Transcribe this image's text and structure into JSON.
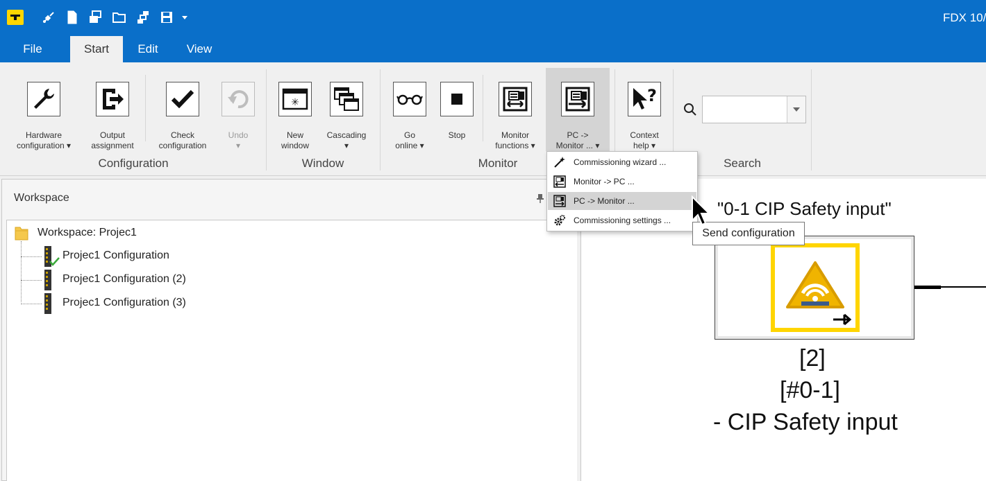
{
  "window": {
    "title": "FDX 10/"
  },
  "quick_access": [
    {
      "icon": "connect-icon"
    },
    {
      "icon": "new-file-icon"
    },
    {
      "icon": "copy-icon"
    },
    {
      "icon": "open-folder-icon"
    },
    {
      "icon": "network-icon"
    },
    {
      "icon": "save-icon"
    },
    {
      "icon": "customize-dropdown-icon"
    }
  ],
  "menu_tabs": [
    {
      "label": "File"
    },
    {
      "label": "Start",
      "active": true
    },
    {
      "label": "Edit"
    },
    {
      "label": "View"
    }
  ],
  "ribbon": {
    "groups": [
      {
        "label": "Configuration"
      },
      {
        "label": "Window"
      },
      {
        "label": "Monitor"
      },
      {
        "label": "Search"
      }
    ],
    "buttons": {
      "hardware_configuration": "Hardware\nconfiguration ▾",
      "output_assignment": "Output\nassignment",
      "check_configuration": "Check\nconfiguration",
      "undo": "Undo\n▾",
      "new_window": "New\nwindow",
      "cascading": "Cascading\n▾",
      "go_online": "Go\nonline ▾",
      "stop": "Stop",
      "monitor_functions": "Monitor\nfunctions ▾",
      "pc_monitor": "PC ->\nMonitor ... ▾",
      "context_help": "Context\nhelp ▾"
    },
    "search": {
      "value": ""
    }
  },
  "dropdown": {
    "items": [
      {
        "label": "Commissioning wizard ...",
        "icon": "wand-icon"
      },
      {
        "label": "Monitor -> PC ...",
        "icon": "monitor-to-pc-icon"
      },
      {
        "label": "PC -> Monitor ...",
        "icon": "pc-to-monitor-icon",
        "highlighted": true
      },
      {
        "label": "Commissioning settings ...",
        "icon": "gears-icon"
      }
    ]
  },
  "tooltip": {
    "text": "Send configuration"
  },
  "workspace": {
    "title": "Workspace",
    "root": "Workspace: Projec1",
    "items": [
      {
        "label": "Projec1 Configuration",
        "checked": true
      },
      {
        "label": "Projec1 Configuration (2)"
      },
      {
        "label": "Projec1 Configuration (3)"
      }
    ]
  },
  "canvas": {
    "node_title": "\"0-1 CIP Safety input\"",
    "node_lines": [
      "[2]",
      "[#0-1]",
      "- CIP Safety input"
    ]
  },
  "colors": {
    "accent": "#0a6fc9",
    "brand_yellow": "#ffd600",
    "menu_highlight": "#d4d4d4"
  }
}
